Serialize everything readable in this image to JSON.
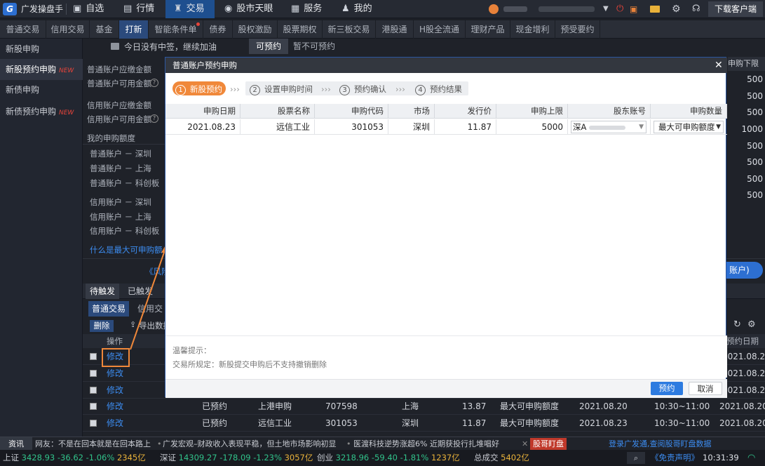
{
  "app": {
    "title": "广发操盘手"
  },
  "topnav": [
    {
      "label": "自选",
      "icon": "▣"
    },
    {
      "label": "行情",
      "icon": "▤"
    },
    {
      "label": "交易",
      "icon": "♜"
    },
    {
      "label": "股市天眼",
      "icon": "◉"
    },
    {
      "label": "服务",
      "icon": "▦"
    },
    {
      "label": "我的",
      "icon": "♟"
    }
  ],
  "topright": {
    "download": "下载客户端"
  },
  "tabs": [
    "普通交易",
    "信用交易",
    "基金",
    "打新",
    "智能条件单",
    "债券",
    "股权激励",
    "股票期权",
    "新三板交易",
    "港股通",
    "H股全流通",
    "理财产品",
    "现金增利",
    "预受要约"
  ],
  "sidebar": {
    "items": [
      {
        "label": "新股申购",
        "new": ""
      },
      {
        "label": "新股预约申购",
        "new": "NEW"
      },
      {
        "label": "新债申购",
        "new": ""
      },
      {
        "label": "新债预约申购",
        "new": "NEW"
      }
    ]
  },
  "main": {
    "notice": "今日没有中签，继续加油",
    "subtabs": [
      "可预约",
      "暂不可预约"
    ],
    "labels": [
      "普通账户应缴金额",
      "普通账户可用金额",
      "信用账户应缴金额",
      "信用账户可用金额"
    ],
    "quota_title": "我的申购额度",
    "quota_items": [
      "普通账户 － 深圳",
      "普通账户 － 上海",
      "普通账户 － 科创板",
      "信用账户 － 深圳",
      "信用账户 － 上海",
      "信用账户 － 科创板"
    ],
    "quota_link": "什么是最大可申购额",
    "right_col_header": "申购下限",
    "right_col_values": [
      "500",
      "500",
      "500",
      "1000",
      "500",
      "500",
      "500",
      "500"
    ],
    "left_link": "《风险",
    "right_button": "账户)"
  },
  "bottom": {
    "tabs": [
      "待触发",
      "已触发"
    ],
    "subtabs": [
      "普通交易",
      "信用交"
    ],
    "delete_btn": "删除",
    "export_btn": "导出数据",
    "op_header": "操作",
    "date_header": "预约日期",
    "rows": [
      {
        "op": "修改",
        "status": "",
        "name": "",
        "code": "",
        "market": "",
        "price": "",
        "qty": "",
        "date": "",
        "time": "",
        "date2": "2021.08.20"
      },
      {
        "op": "修改",
        "status": "",
        "name": "",
        "code": "",
        "market": "",
        "price": "",
        "qty": "",
        "date": "",
        "time": "",
        "date2": "2021.08.20"
      },
      {
        "op": "修改",
        "status": "",
        "name": "",
        "code": "",
        "market": "",
        "price": "",
        "qty": "",
        "date": "",
        "time": "",
        "date2": "2021.08.20"
      },
      {
        "op": "修改",
        "status": "已预约",
        "name": "上港申购",
        "code": "707598",
        "market": "上海",
        "price": "13.87",
        "qty": "最大可申购额度",
        "date": "2021.08.20",
        "time": "10:30~11:00",
        "date2": "2021.08.20"
      },
      {
        "op": "修改",
        "status": "已预约",
        "name": "远信工业",
        "code": "301053",
        "market": "深圳",
        "price": "11.87",
        "qty": "最大可申购额度",
        "date": "2021.08.23",
        "time": "10:30~11:00",
        "date2": "2021.08.20"
      }
    ]
  },
  "modal": {
    "title": "普通账户预约申购",
    "steps": [
      {
        "n": "1",
        "label": "新股预约"
      },
      {
        "n": "2",
        "label": "设置申购时间"
      },
      {
        "n": "3",
        "label": "预约确认"
      },
      {
        "n": "4",
        "label": "预约结果"
      }
    ],
    "step_sep": "›››",
    "headers": [
      "申购日期",
      "股票名称",
      "申购代码",
      "市场",
      "发行价",
      "申购上限",
      "股东账号",
      "申购数量"
    ],
    "row": {
      "date": "2021.08.23",
      "name": "远信工业",
      "code": "301053",
      "market": "深圳",
      "price": "11.87",
      "limit": "5000",
      "account": "深A",
      "qty": "最大可申购额度"
    },
    "tip_title": "温馨提示：",
    "tip_text": "交易所规定：新股提交申购后不支持撤销删除",
    "confirm": "预约",
    "cancel": "取消"
  },
  "ticker": {
    "tag": "资讯",
    "items": [
      "网友：不是在回本就是在回本路上",
      "广发宏观–财政收入表现平稳，但土地市场影响初显",
      "医渡科技逆势涨超6% 近期获投行扎堆唱好"
    ],
    "badge": "股哥盯盘",
    "right": "登录广发通,查阅股哥盯盘数据"
  },
  "status": {
    "sh": {
      "name": "上证",
      "value": "3428.93",
      "chg": "-36.62",
      "pct": "-1.06%",
      "amt": "2345亿"
    },
    "sz": {
      "name": "深证",
      "value": "14309.27",
      "chg": "-178.09",
      "pct": "-1.23%",
      "amt": "3057亿"
    },
    "cy": {
      "name": "创业",
      "value": "3218.96",
      "chg": "-59.40",
      "pct": "-1.81%",
      "amt": "1237亿"
    },
    "total_label": "总成交",
    "total": "5402亿",
    "disclaimer": "《免责声明》",
    "time": "10:31:39"
  },
  "colors": {
    "accent": "#1e4f8f",
    "link": "#3c8cf0",
    "orange": "#f0883a",
    "down": "#31c28a"
  }
}
